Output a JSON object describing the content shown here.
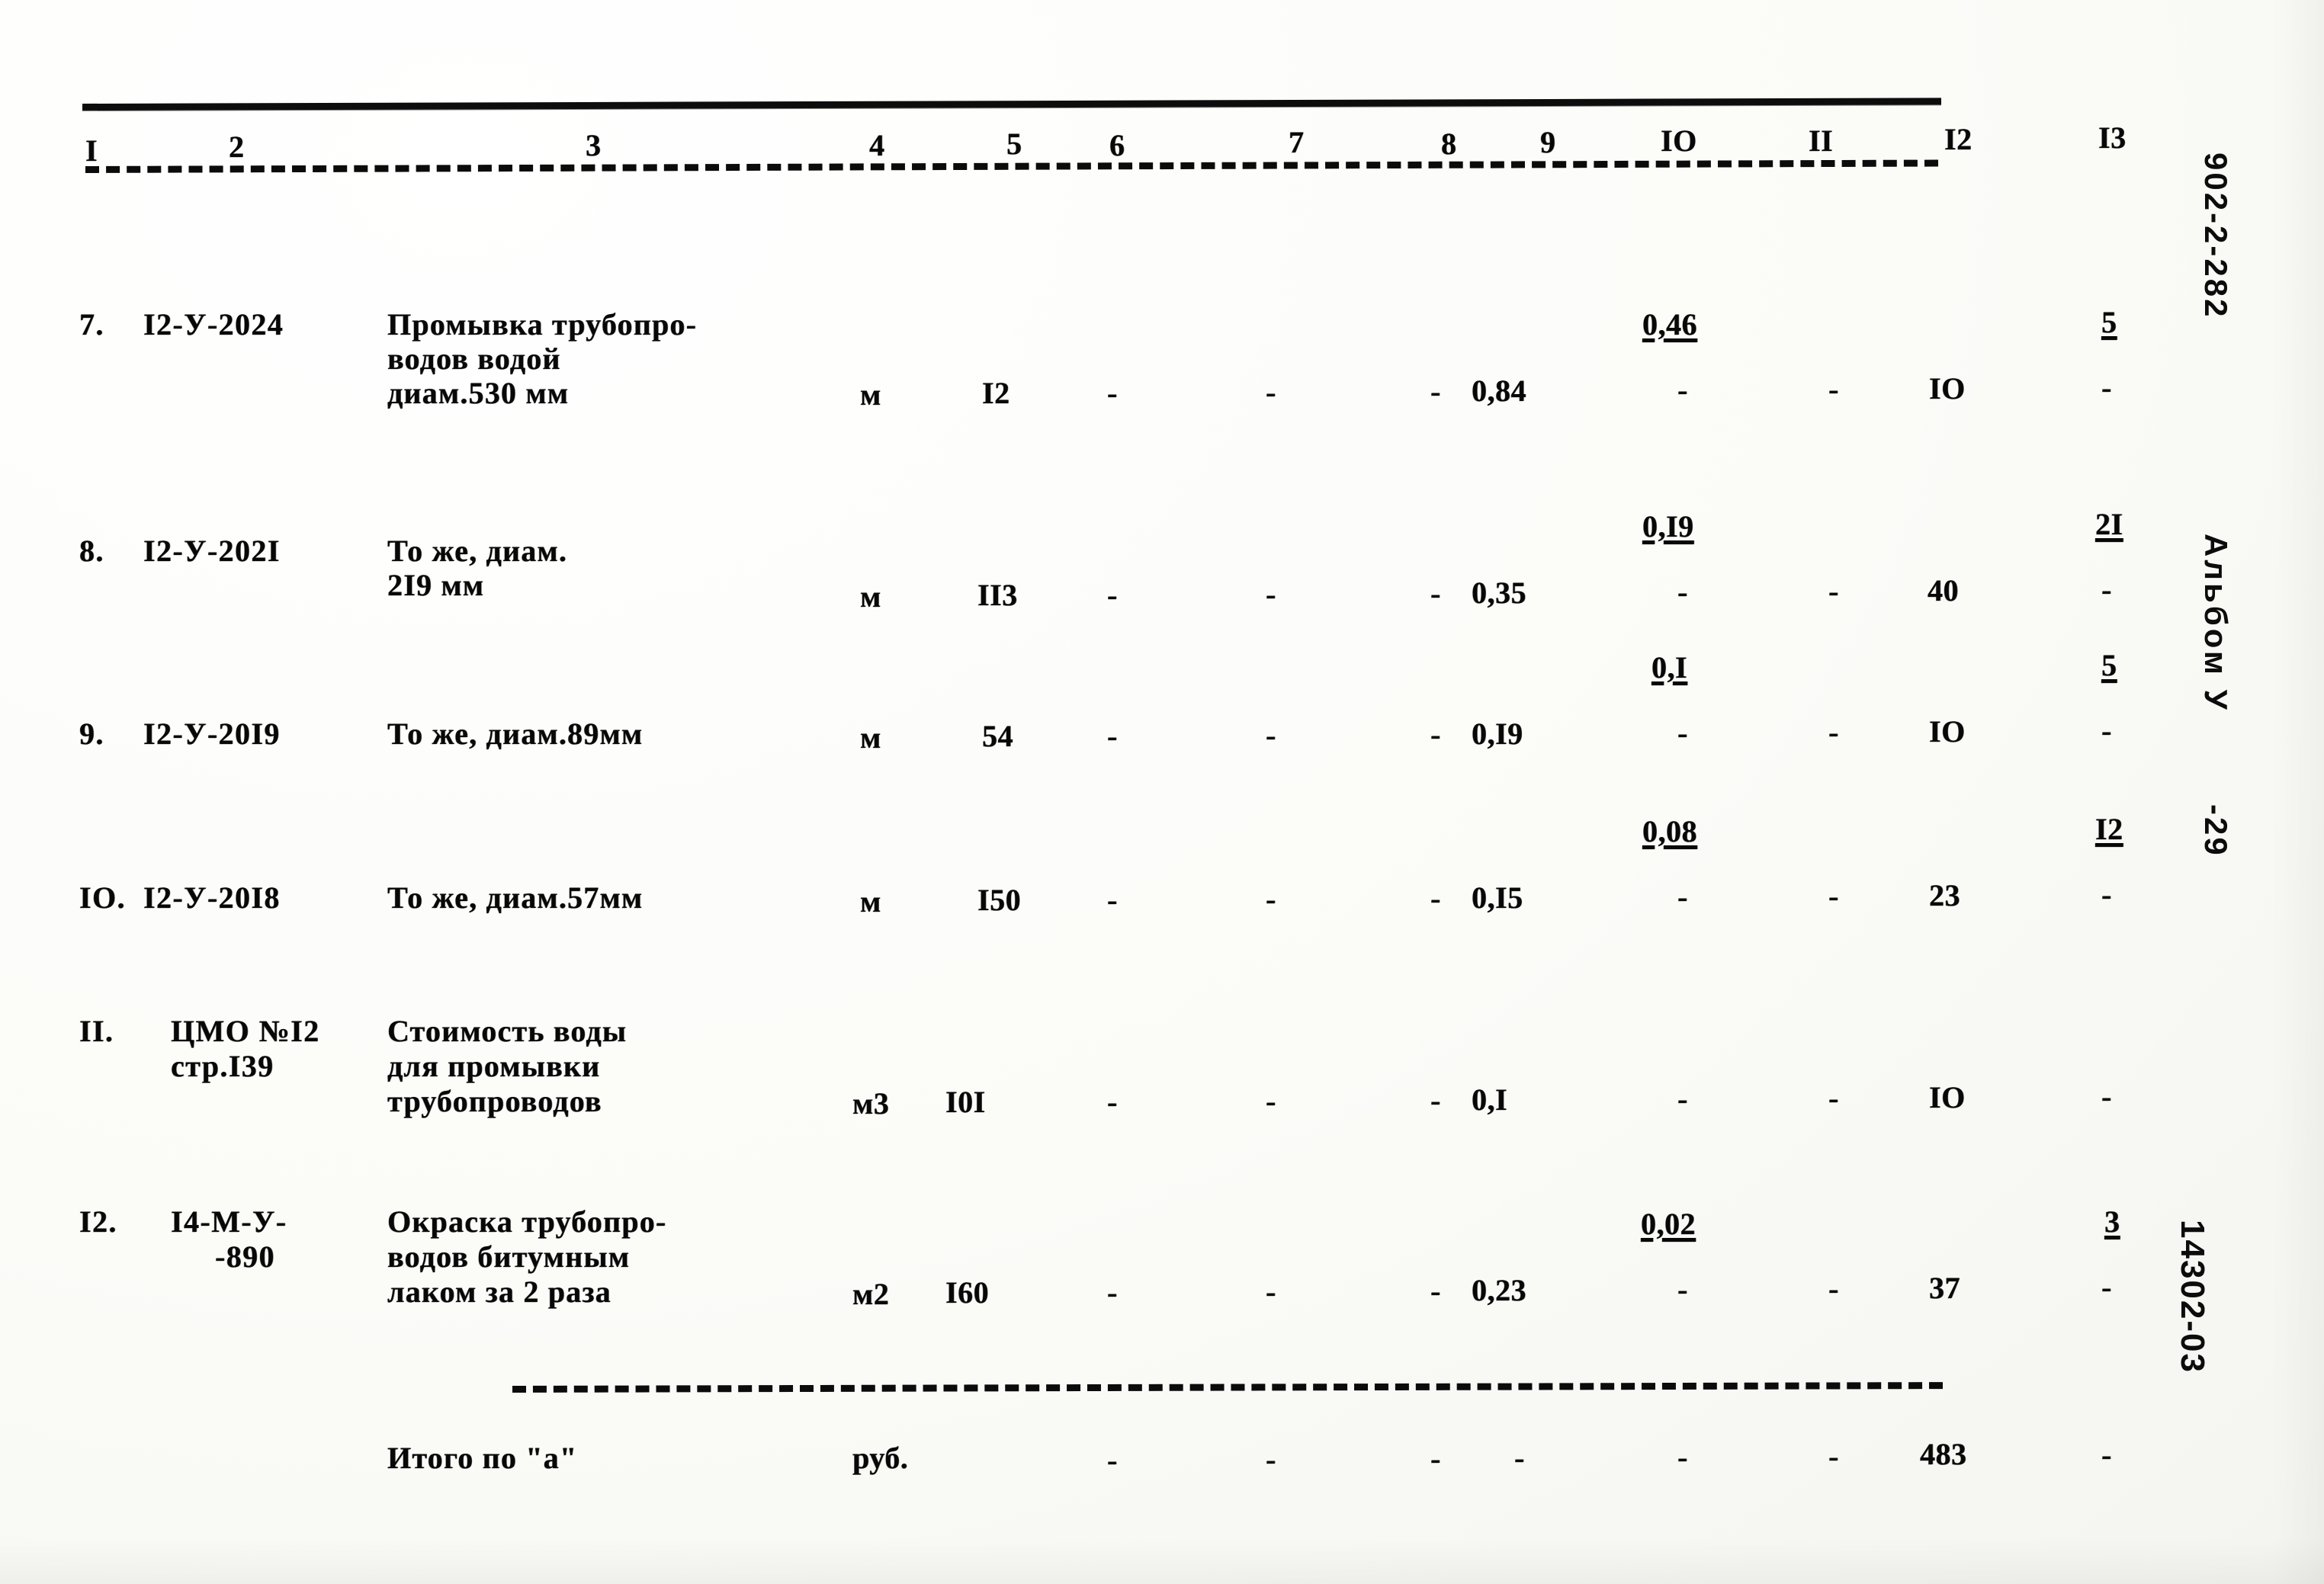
{
  "document": {
    "type": "estimate-table",
    "margin_stamps": {
      "series_code": "902-2-282",
      "album": "Альбом У",
      "sheet": "-29",
      "drawing_no": "14302-03"
    }
  },
  "table": {
    "column_headers": [
      "I",
      "2",
      "3",
      "4",
      "5",
      "6",
      "7",
      "8",
      "9",
      "IO",
      "II",
      "I2",
      "I3"
    ],
    "rows": [
      {
        "no": "7.",
        "code": "I2-У-2024",
        "description": [
          "Промывка трубопро-",
          "водов водой",
          "диам.530 мм"
        ],
        "unit": "м",
        "qty": "I2",
        "c6": "-",
        "c7": "-",
        "c8": "-",
        "c9": "0,84",
        "c10_top": "0,46",
        "c10": "-",
        "c11": "-",
        "c12": "IO",
        "c13_top": "5",
        "c13": "-"
      },
      {
        "no": "8.",
        "code": "I2-У-202I",
        "description": [
          "То же, диам.",
          "2I9 мм"
        ],
        "unit": "м",
        "qty": "II3",
        "c6": "-",
        "c7": "-",
        "c8": "-",
        "c9": "0,35",
        "c10_top": "0,I9",
        "c10": "-",
        "c11": "-",
        "c12": "40",
        "c13_top": "2I",
        "c13": "-"
      },
      {
        "no": "9.",
        "code": "I2-У-20I9",
        "description": [
          "То же, диам.89мм"
        ],
        "unit": "м",
        "qty": "54",
        "c6": "-",
        "c7": "-",
        "c8": "-",
        "c9": "0,I9",
        "c10_top": "0,I",
        "c10": "-",
        "c11": "-",
        "c12": "IO",
        "c13_top": "5",
        "c13": "-"
      },
      {
        "no": "IO.",
        "code": "I2-У-20I8",
        "description": [
          "То же, диам.57мм"
        ],
        "unit": "м",
        "qty": "I50",
        "c6": "-",
        "c7": "-",
        "c8": "-",
        "c9": "0,I5",
        "c10_top": "0,08",
        "c10": "-",
        "c11": "-",
        "c12": "23",
        "c13_top": "I2",
        "c13": "-"
      },
      {
        "no": "II.",
        "code": "ЦМО №I2",
        "code2": "стр.I39",
        "description": [
          "Стоимость воды",
          "для промывки",
          "трубопроводов"
        ],
        "unit": "м3",
        "qty": "I0I",
        "c6": "-",
        "c7": "-",
        "c8": "-",
        "c9": "0,I",
        "c10_top": "",
        "c10": "-",
        "c11": "-",
        "c12": "IO",
        "c13_top": "",
        "c13": "-"
      },
      {
        "no": "I2.",
        "code": "I4-М-У-",
        "code2": "-890",
        "description": [
          "Окраска трубопро-",
          "водов битумным",
          "лаком за 2 раза"
        ],
        "unit": "м2",
        "qty": "I60",
        "c6": "-",
        "c7": "-",
        "c8": "-",
        "c9": "0,23",
        "c10_top": "0,02",
        "c10": "-",
        "c11": "-",
        "c12": "37",
        "c13_top": "3",
        "c13": "-"
      }
    ],
    "total_row": {
      "label": "Итого по \"а\"",
      "unit": "руб.",
      "c5": "-",
      "c6": "-",
      "c7": "-",
      "c8": "-",
      "c9": "-",
      "c10": "-",
      "c11": "-",
      "c12": "483",
      "c13": "-"
    }
  }
}
